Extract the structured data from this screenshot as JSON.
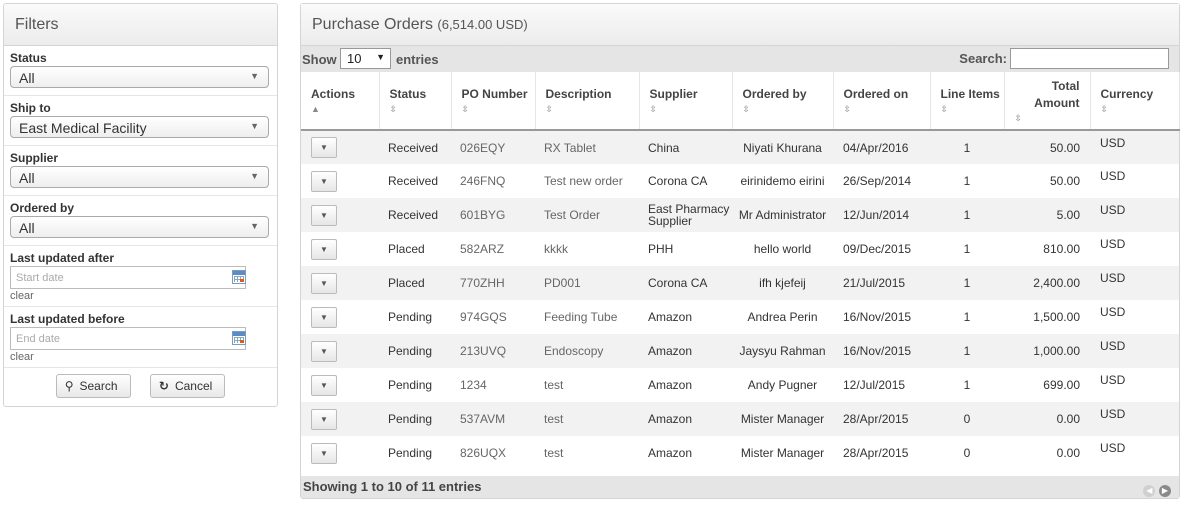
{
  "filters": {
    "title": "Filters",
    "status": {
      "label": "Status",
      "value": "All"
    },
    "ship_to": {
      "label": "Ship to",
      "value": "East Medical Facility"
    },
    "supplier": {
      "label": "Supplier",
      "value": "All"
    },
    "ordered_by": {
      "label": "Ordered by",
      "value": "All"
    },
    "updated_after": {
      "label": "Last updated after",
      "placeholder": "Start date",
      "clear": "clear"
    },
    "updated_before": {
      "label": "Last updated before",
      "placeholder": "End date",
      "clear": "clear"
    },
    "search_button": "Search",
    "cancel_button": "Cancel"
  },
  "orders": {
    "title": "Purchase Orders",
    "total": "(6,514.00 USD)",
    "show_label": "Show",
    "page_length": "10",
    "entries_label": "entries",
    "search_label": "Search:",
    "search_value": "",
    "columns": {
      "actions": "Actions",
      "status": "Status",
      "po_number": "PO Number",
      "description": "Description",
      "supplier": "Supplier",
      "ordered_by": "Ordered by",
      "ordered_on": "Ordered on",
      "line_items": "Line Items",
      "total_amount": "Total Amount",
      "currency": "Currency"
    },
    "rows": [
      {
        "status": "Received",
        "po": "026EQY",
        "desc": "RX Tablet",
        "supplier": "China",
        "by": "Niyati Khurana",
        "on": "04/Apr/2016",
        "items": "1",
        "amount": "50.00",
        "currency": "USD"
      },
      {
        "status": "Received",
        "po": "246FNQ",
        "desc": "Test new order",
        "supplier": "Corona CA",
        "by": "eirinidemo eirini",
        "on": "26/Sep/2014",
        "items": "1",
        "amount": "50.00",
        "currency": "USD"
      },
      {
        "status": "Received",
        "po": "601BYG",
        "desc": "Test Order",
        "supplier": "East Pharmacy Supplier",
        "by": "Mr Administrator",
        "on": "12/Jun/2014",
        "items": "1",
        "amount": "5.00",
        "currency": "USD"
      },
      {
        "status": "Placed",
        "po": "582ARZ",
        "desc": "kkkk",
        "supplier": "PHH",
        "by": "hello world",
        "on": "09/Dec/2015",
        "items": "1",
        "amount": "810.00",
        "currency": "USD"
      },
      {
        "status": "Placed",
        "po": "770ZHH",
        "desc": "PD001",
        "supplier": "Corona CA",
        "by": "ifh kjefeij",
        "on": "21/Jul/2015",
        "items": "1",
        "amount": "2,400.00",
        "currency": "USD"
      },
      {
        "status": "Pending",
        "po": "974GQS",
        "desc": "Feeding Tube",
        "supplier": "Amazon",
        "by": "Andrea Perin",
        "on": "16/Nov/2015",
        "items": "1",
        "amount": "1,500.00",
        "currency": "USD"
      },
      {
        "status": "Pending",
        "po": "213UVQ",
        "desc": "Endoscopy",
        "supplier": "Amazon",
        "by": "Jaysyu Rahman",
        "on": "16/Nov/2015",
        "items": "1",
        "amount": "1,000.00",
        "currency": "USD"
      },
      {
        "status": "Pending",
        "po": "1234",
        "desc": "test",
        "supplier": "Amazon",
        "by": "Andy Pugner",
        "on": "12/Jul/2015",
        "items": "1",
        "amount": "699.00",
        "currency": "USD"
      },
      {
        "status": "Pending",
        "po": "537AVM",
        "desc": "test",
        "supplier": "Amazon",
        "by": "Mister Manager",
        "on": "28/Apr/2015",
        "items": "0",
        "amount": "0.00",
        "currency": "USD"
      },
      {
        "status": "Pending",
        "po": "826UQX",
        "desc": "test",
        "supplier": "Amazon",
        "by": "Mister Manager",
        "on": "28/Apr/2015",
        "items": "0",
        "amount": "0.00",
        "currency": "USD"
      }
    ],
    "footer": "Showing 1 to 10 of 11 entries"
  },
  "icons": {
    "dropdown": "chevron-down-icon",
    "calendar": "calendar-icon",
    "search": "search-icon",
    "cancel": "refresh-icon",
    "sort": "sort-icon",
    "prev": "prev-page-icon",
    "next": "next-page-icon"
  }
}
